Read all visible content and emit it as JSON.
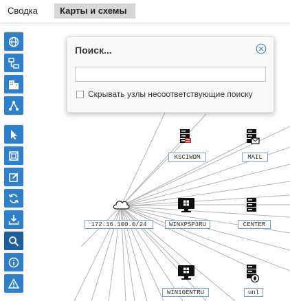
{
  "tabs": [
    {
      "label": "Сводка",
      "active": false
    },
    {
      "label": "Карты и схемы",
      "active": true
    }
  ],
  "toolbar": {
    "group1": [
      {
        "icon": "globe-icon"
      },
      {
        "icon": "topology-icon"
      },
      {
        "icon": "buildings-icon"
      },
      {
        "icon": "graph-nodes-icon"
      }
    ],
    "group2": [
      {
        "icon": "cursor-icon"
      },
      {
        "icon": "fit-frame-icon"
      },
      {
        "icon": "edit-icon"
      },
      {
        "icon": "refresh-icon"
      },
      {
        "icon": "download-icon"
      },
      {
        "icon": "search-icon"
      },
      {
        "icon": "info-icon"
      },
      {
        "icon": "warning-icon"
      }
    ]
  },
  "search": {
    "title": "Поиск...",
    "input_value": "",
    "hide_label": "Скрывать узлы несоответствующие поиску",
    "hide_checked": false
  },
  "nodes": {
    "ksciwdm": {
      "label": "KSCIWDM",
      "icon": "server-icon"
    },
    "mail": {
      "label": "MAIL",
      "icon": "mail-server-icon"
    },
    "subnet": {
      "label": "172.16.100.0/24",
      "icon": "cloud-icon"
    },
    "winxpsp3ru": {
      "label": "WINXPSP3RU",
      "icon": "windows-monitor-icon"
    },
    "center": {
      "label": "CENTER",
      "icon": "server-icon"
    },
    "win10entru": {
      "label": "WIN10ENTRU",
      "icon": "windows-monitor-icon"
    },
    "unl": {
      "label": "unl",
      "icon": "linux-server-icon"
    }
  },
  "colors": {
    "accent": "#2f80c8",
    "tab_active": "#d7d7d7",
    "link_line": "#b0b0b0",
    "label_border": "#6fa3d4"
  }
}
